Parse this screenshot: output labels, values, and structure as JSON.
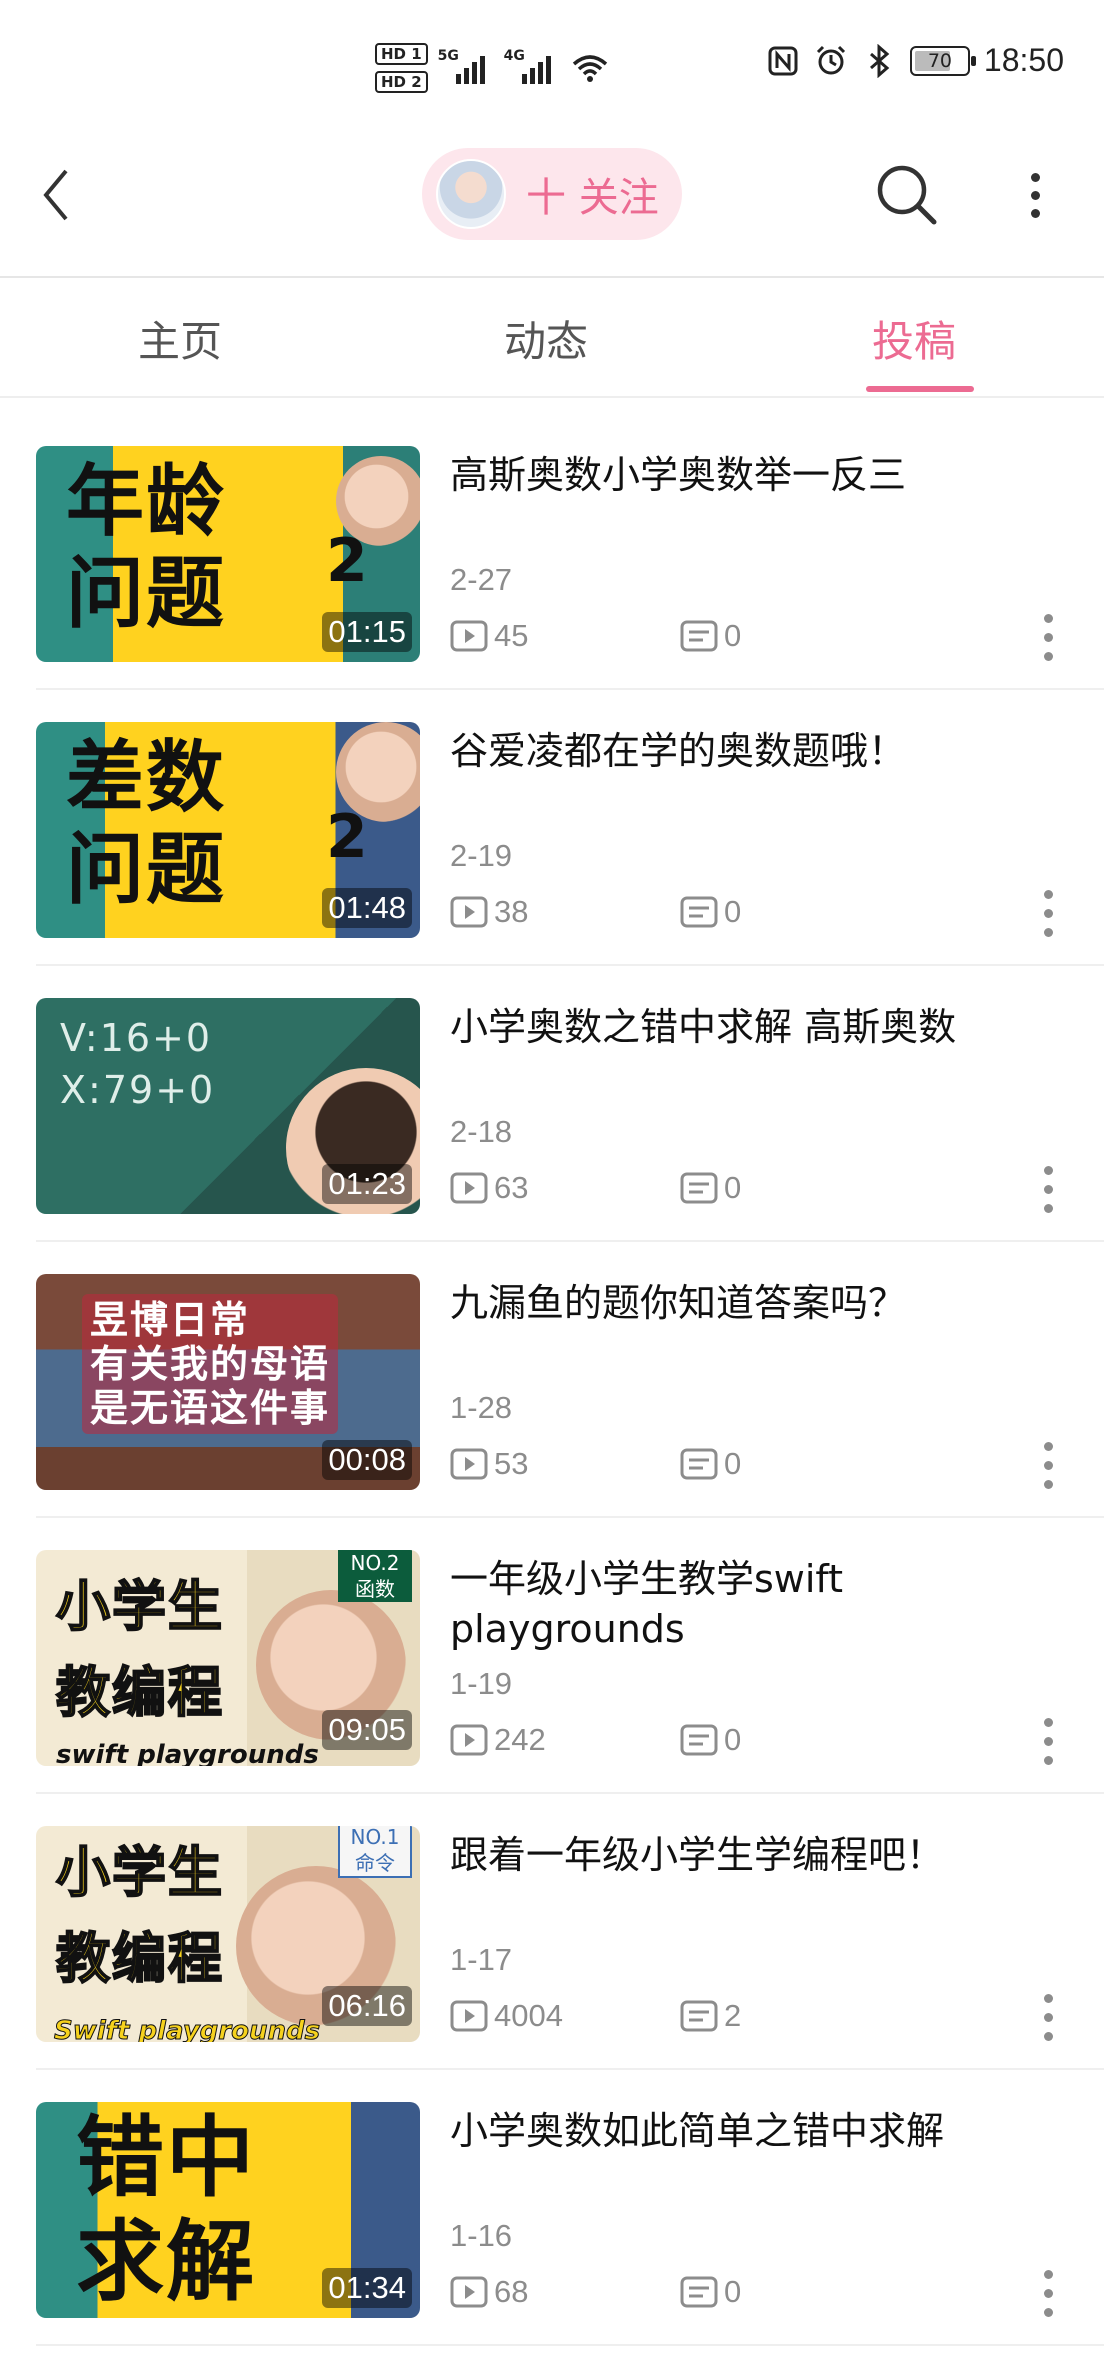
{
  "status_bar": {
    "hd1": "HD 1",
    "hd2": "HD 2",
    "net1": "5G",
    "net2": "4G",
    "battery": "70",
    "battery_level": 0.7,
    "time": "18:50"
  },
  "header": {
    "follow_label": "十 关注"
  },
  "tabs": [
    {
      "label": "主页"
    },
    {
      "label": "动态"
    },
    {
      "label": "投稿",
      "active": true
    }
  ],
  "accent_color": "#ec6b92",
  "videos": [
    {
      "title": "高斯奥数小学奥数举一反三",
      "thumb_text": "年龄\n问题",
      "thumb_sup": "2",
      "duration": "01:15",
      "date": "2-27",
      "plays": "45",
      "comments": "0"
    },
    {
      "title": "谷爱凌都在学的奥数题哦！",
      "thumb_text": "差数\n问题",
      "thumb_sup": "2",
      "duration": "01:48",
      "date": "2-19",
      "plays": "38",
      "comments": "0"
    },
    {
      "title": "小学奥数之错中求解 高斯奥数",
      "thumb_text": "V:16+0\nX:79+0",
      "duration": "01:23",
      "date": "2-18",
      "plays": "63",
      "comments": "0"
    },
    {
      "title": "九漏鱼的题你知道答案吗？",
      "thumb_text": "昱博日常\n有关我的母语\n是无语这件事",
      "duration": "00:08",
      "date": "1-28",
      "plays": "53",
      "comments": "0"
    },
    {
      "title": "一年级小学生教学swift playgrounds",
      "thumb_text": "小学生\n教编程",
      "thumb_badge": "NO.2\n函数",
      "thumb_foot": "swift playgrounds",
      "duration": "09:05",
      "date": "1-19",
      "plays": "242",
      "comments": "0"
    },
    {
      "title": "跟着一年级小学生学编程吧！",
      "thumb_text": "小学生\n教编程",
      "thumb_badge": "NO.1\n命令",
      "thumb_foot": "Swift playgrounds",
      "duration": "06:16",
      "date": "1-17",
      "plays": "4004",
      "comments": "2"
    },
    {
      "title": "小学奥数如此简单之错中求解",
      "thumb_text": "错中\n求解",
      "duration": "01:34",
      "date": "1-16",
      "plays": "68",
      "comments": "0"
    }
  ]
}
